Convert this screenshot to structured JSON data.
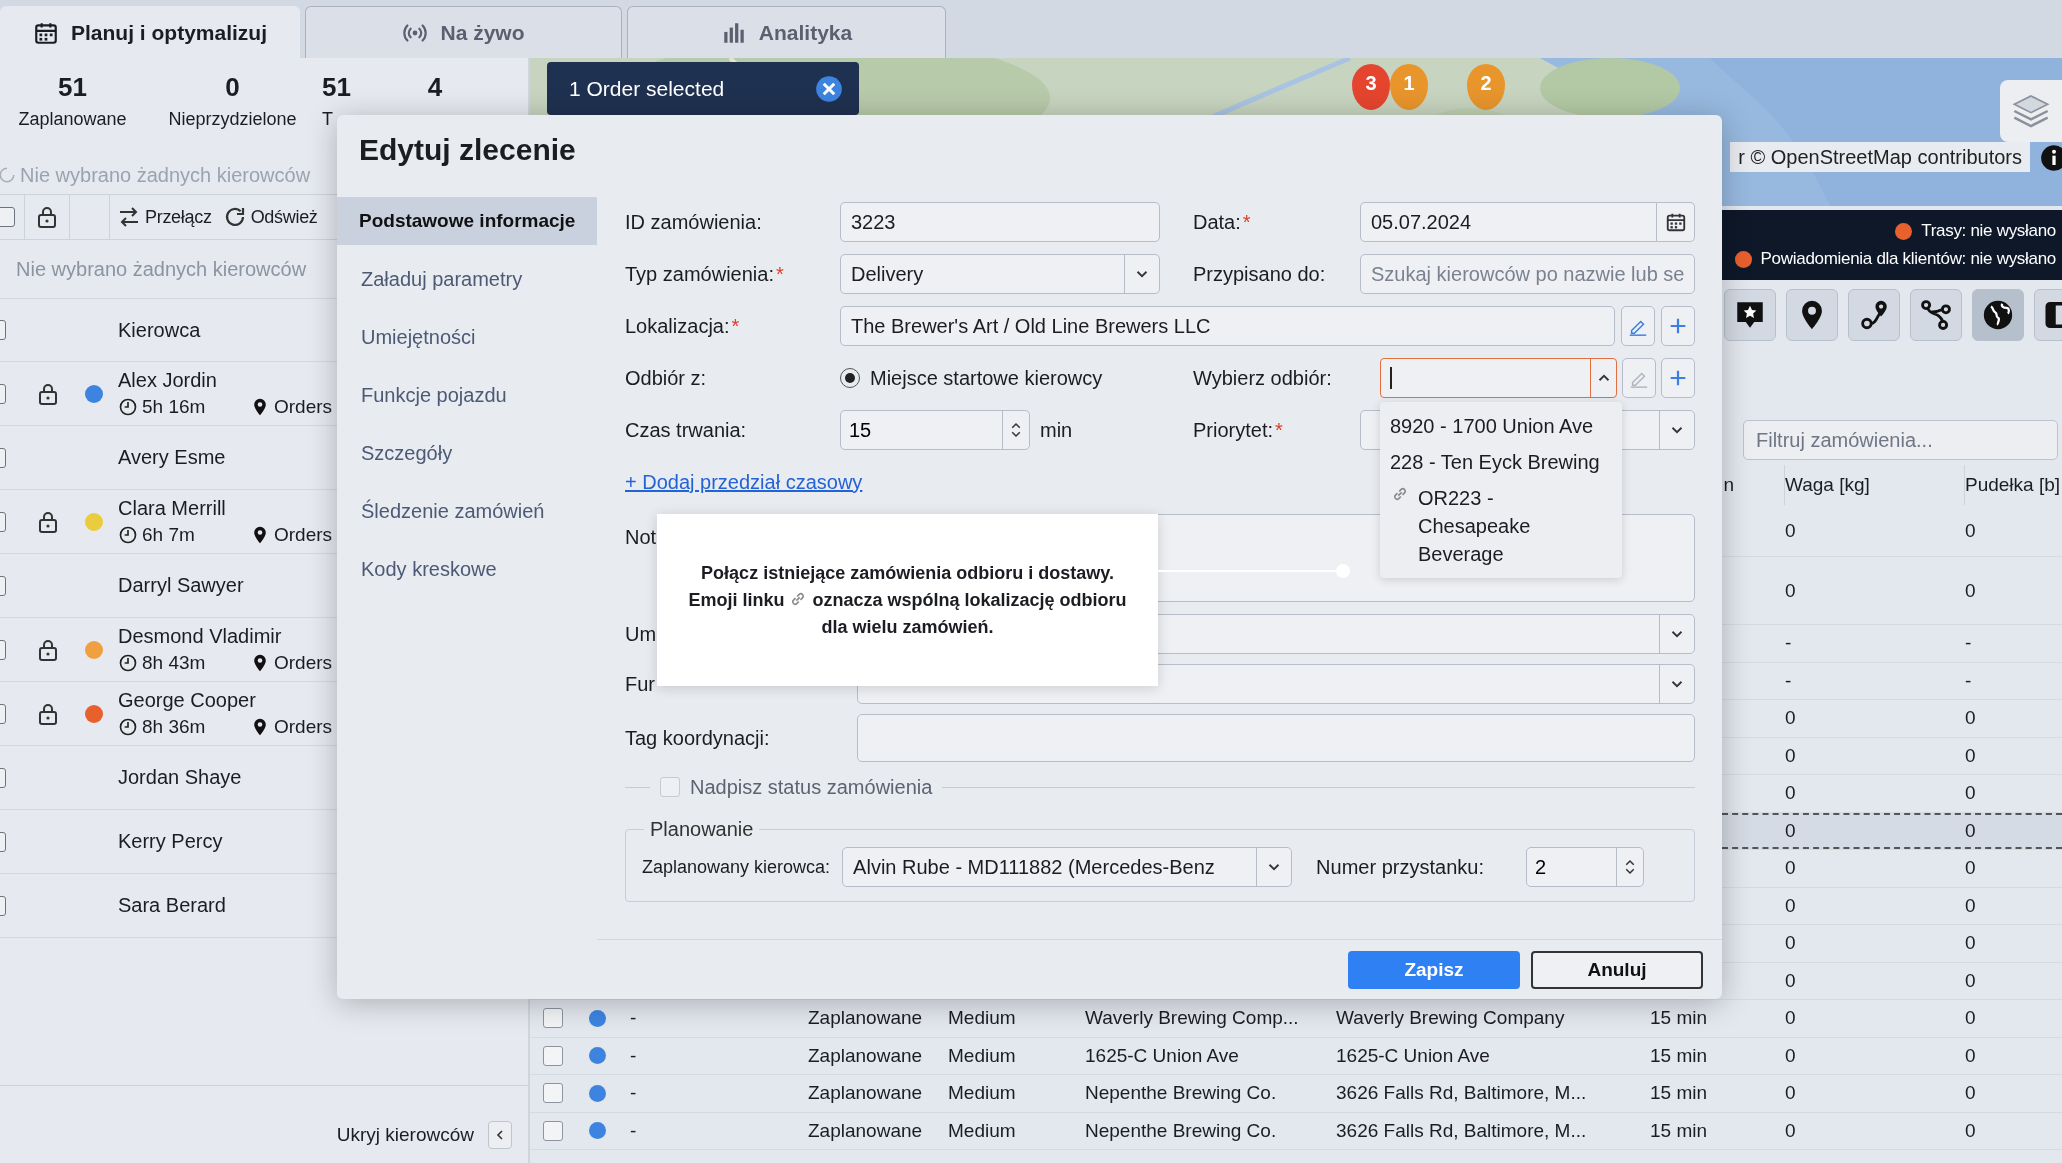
{
  "tabs": [
    {
      "label": "Planuj i optymalizuj",
      "selected": true
    },
    {
      "label": "Na żywo",
      "selected": false
    },
    {
      "label": "Analityka",
      "selected": false
    }
  ],
  "driver_panel": {
    "stats": [
      {
        "value": "51",
        "label": "Zaplanowane"
      },
      {
        "value": "0",
        "label": "Nieprzydzielone"
      },
      {
        "value": "51",
        "label": "T"
      },
      {
        "value": "4"
      }
    ],
    "status_top": "Nie wybrano żadnych kierowców",
    "select_all": {
      "checked": false
    },
    "toolbar": [
      {
        "label": "Przełącz"
      },
      {
        "label": "Odśwież"
      }
    ],
    "status": "Nie wybrano żadnych kierowców",
    "header": {
      "label": "Kierowca",
      "checked": false
    },
    "drivers": [
      {
        "kind": "route",
        "name": "Alex Jordin",
        "checked": false,
        "color": "#3d84e0",
        "duration": "5h 16m",
        "orders": "Orders"
      },
      {
        "kind": "empty",
        "name": "Avery Esme",
        "checked": false
      },
      {
        "kind": "route",
        "name": "Clara Merrill",
        "checked": false,
        "color": "#e9cd3c",
        "duration": "6h 7m",
        "orders": "Orders"
      },
      {
        "kind": "empty",
        "name": "Darryl Sawyer",
        "checked": false
      },
      {
        "kind": "route",
        "name": "Desmond Vladimir",
        "checked": false,
        "color": "#f0a040",
        "duration": "8h 43m",
        "orders": "Orders"
      },
      {
        "kind": "route",
        "name": "George Cooper",
        "checked": false,
        "color": "#e8602c",
        "duration": "8h 36m",
        "orders": "Orders"
      },
      {
        "kind": "empty",
        "name": "Jordan Shaye",
        "checked": false
      },
      {
        "kind": "empty",
        "name": "Kerry Percy",
        "checked": false
      },
      {
        "kind": "empty",
        "name": "Sara Berard",
        "checked": false
      }
    ],
    "hide_button": "Ukryj kierowców"
  },
  "map": {
    "kind": "picture",
    "selection_banner": "1 Order selected",
    "markers": [
      {
        "label": "3",
        "color": "#e5452f"
      },
      {
        "label": "1",
        "color": "#e8952c"
      },
      {
        "label": "2",
        "color": "#e8952c"
      }
    ],
    "attribution": "r © OpenStreetMap contributors"
  },
  "status_bar": [
    {
      "label": "Trasy: nie wysłano",
      "color": "#e8602c"
    },
    {
      "label": "Powiadomienia dla klientów: nie wysłano",
      "color": "#e8602c"
    }
  ],
  "map_tools": [
    {
      "active": false
    },
    {
      "active": false
    },
    {
      "active": false
    },
    {
      "active": false
    },
    {
      "active": true
    },
    {
      "active": false
    }
  ],
  "filter": {
    "placeholder": "Filtruj zamówienia..."
  },
  "table": {
    "columns": [
      "n",
      "Waga [kg]",
      "Pudełka [b]"
    ],
    "rows": [
      {
        "kind": "partial",
        "selected": false,
        "weight": "0",
        "boxes": "0"
      },
      {
        "kind": "partial",
        "selected": false,
        "weight": "0",
        "boxes": "0"
      },
      {
        "kind": "partial",
        "selected": false,
        "weight": "-",
        "boxes": "-"
      },
      {
        "kind": "partial",
        "selected": false,
        "weight": "-",
        "boxes": "-"
      },
      {
        "kind": "partial",
        "selected": false,
        "weight": "0",
        "boxes": "0"
      },
      {
        "kind": "partial",
        "selected": false,
        "weight": "0",
        "boxes": "0"
      },
      {
        "kind": "partial",
        "selected": false,
        "weight": "0",
        "boxes": "0"
      },
      {
        "kind": "partial",
        "selected": true,
        "weight": "0",
        "boxes": "0"
      },
      {
        "kind": "partial",
        "selected": false,
        "weight": "0",
        "boxes": "0"
      },
      {
        "kind": "partial",
        "selected": false,
        "weight": "0",
        "boxes": "0"
      },
      {
        "kind": "partial",
        "selected": false,
        "weight": "0",
        "boxes": "0"
      },
      {
        "kind": "partial",
        "selected": false,
        "weight": "0",
        "boxes": "0"
      },
      {
        "kind": "full",
        "selected": false,
        "checked": false,
        "color": "#3d84e0",
        "cells": [
          "-",
          "Zaplanowane",
          "Medium",
          "Waverly Brewing Comp...",
          "Waverly Brewing Company",
          "15 min"
        ],
        "weight": "0",
        "boxes": "0"
      },
      {
        "kind": "full",
        "selected": false,
        "checked": false,
        "color": "#3d84e0",
        "cells": [
          "-",
          "Zaplanowane",
          "Medium",
          "1625-C Union Ave",
          "1625-C Union Ave",
          "15 min"
        ],
        "weight": "0",
        "boxes": "0"
      },
      {
        "kind": "full",
        "selected": false,
        "checked": false,
        "color": "#3d84e0",
        "cells": [
          "-",
          "Zaplanowane",
          "Medium",
          "Nepenthe Brewing Co.",
          "3626 Falls Rd, Baltimore, M...",
          "15 min"
        ],
        "weight": "0",
        "boxes": "0"
      },
      {
        "kind": "full",
        "selected": false,
        "checked": false,
        "color": "#3d84e0",
        "cells": [
          "-",
          "Zaplanowane",
          "Medium",
          "Nepenthe Brewing Co.",
          "3626 Falls Rd, Baltimore, M...",
          "15 min"
        ],
        "weight": "0",
        "boxes": "0"
      }
    ]
  },
  "dialog": {
    "title": "Edytuj zlecenie",
    "nav": [
      {
        "label": "Podstawowe informacje",
        "selected": true
      },
      {
        "label": "Załaduj parametry",
        "selected": false
      },
      {
        "label": "Umiejętności",
        "selected": false
      },
      {
        "label": "Funkcje pojazdu",
        "selected": false
      },
      {
        "label": "Szczegóły",
        "selected": false
      },
      {
        "label": "Śledzenie zamówień",
        "selected": false
      },
      {
        "label": "Kody kreskowe",
        "selected": false
      }
    ],
    "order_id": {
      "label": "ID zamówienia:",
      "value": "3223"
    },
    "date": {
      "label": "Data:",
      "mark": "*",
      "value": "05.07.2024"
    },
    "order_type": {
      "label": "Typ zamówienia:",
      "mark": "*",
      "value": "Delivery"
    },
    "assigned_to": {
      "label": "Przypisano do:",
      "placeholder": "Szukaj kierowców po nazwie lub se"
    },
    "location": {
      "label": "Lokalizacja:",
      "mark": "*",
      "value": "The Brewer's Art / Old Line Brewers LLC",
      "edit_disabled": false
    },
    "pickup_from": {
      "label": "Odbiór z:",
      "option": "Miejsce startowe kierowcy",
      "selected": true
    },
    "pickup": {
      "label": "Wybierz odbiór:",
      "expanded": true,
      "edit_disabled": true,
      "options": [
        {
          "kind": "plain",
          "label": "8920 - 1700 Union Ave"
        },
        {
          "kind": "plain",
          "label": "228 - Ten Eyck Brewing"
        },
        {
          "kind": "linked",
          "label": "OR223 - Chesapeake Beverage"
        }
      ]
    },
    "duration": {
      "label": "Czas trwania:",
      "value": "15",
      "unit": "min"
    },
    "priority": {
      "label": "Priorytet:",
      "mark": "*"
    },
    "add_time_window": "+ Dodaj przedział czasowy",
    "notes": {
      "label": "Not"
    },
    "skills": {
      "label": "Um"
    },
    "vehicle_features": {
      "label": "Fur"
    },
    "coordination_tag": {
      "label": "Tag koordynacji:"
    },
    "override_status": {
      "label": "Nadpisz status zamówienia",
      "checked": false
    },
    "planning": {
      "legend": "Planowanie",
      "driver_label": "Zaplanowany kierowca:",
      "driver": "Alvin Rube - MD111882 (Mercedes-Benz",
      "stop_label": "Numer przystanku:",
      "stop": "2"
    },
    "tooltip": {
      "sentence": "Połącz istniejące zamówienia odbioru i dostawy.",
      "before_icon": "Emoji linku",
      "after_icon": "oznacza wspólną lokalizację odbioru dla wielu zamówień."
    },
    "buttons": [
      {
        "kind": "primary",
        "label": "Zapisz"
      },
      {
        "kind": "secondary",
        "label": "Anuluj"
      }
    ]
  }
}
